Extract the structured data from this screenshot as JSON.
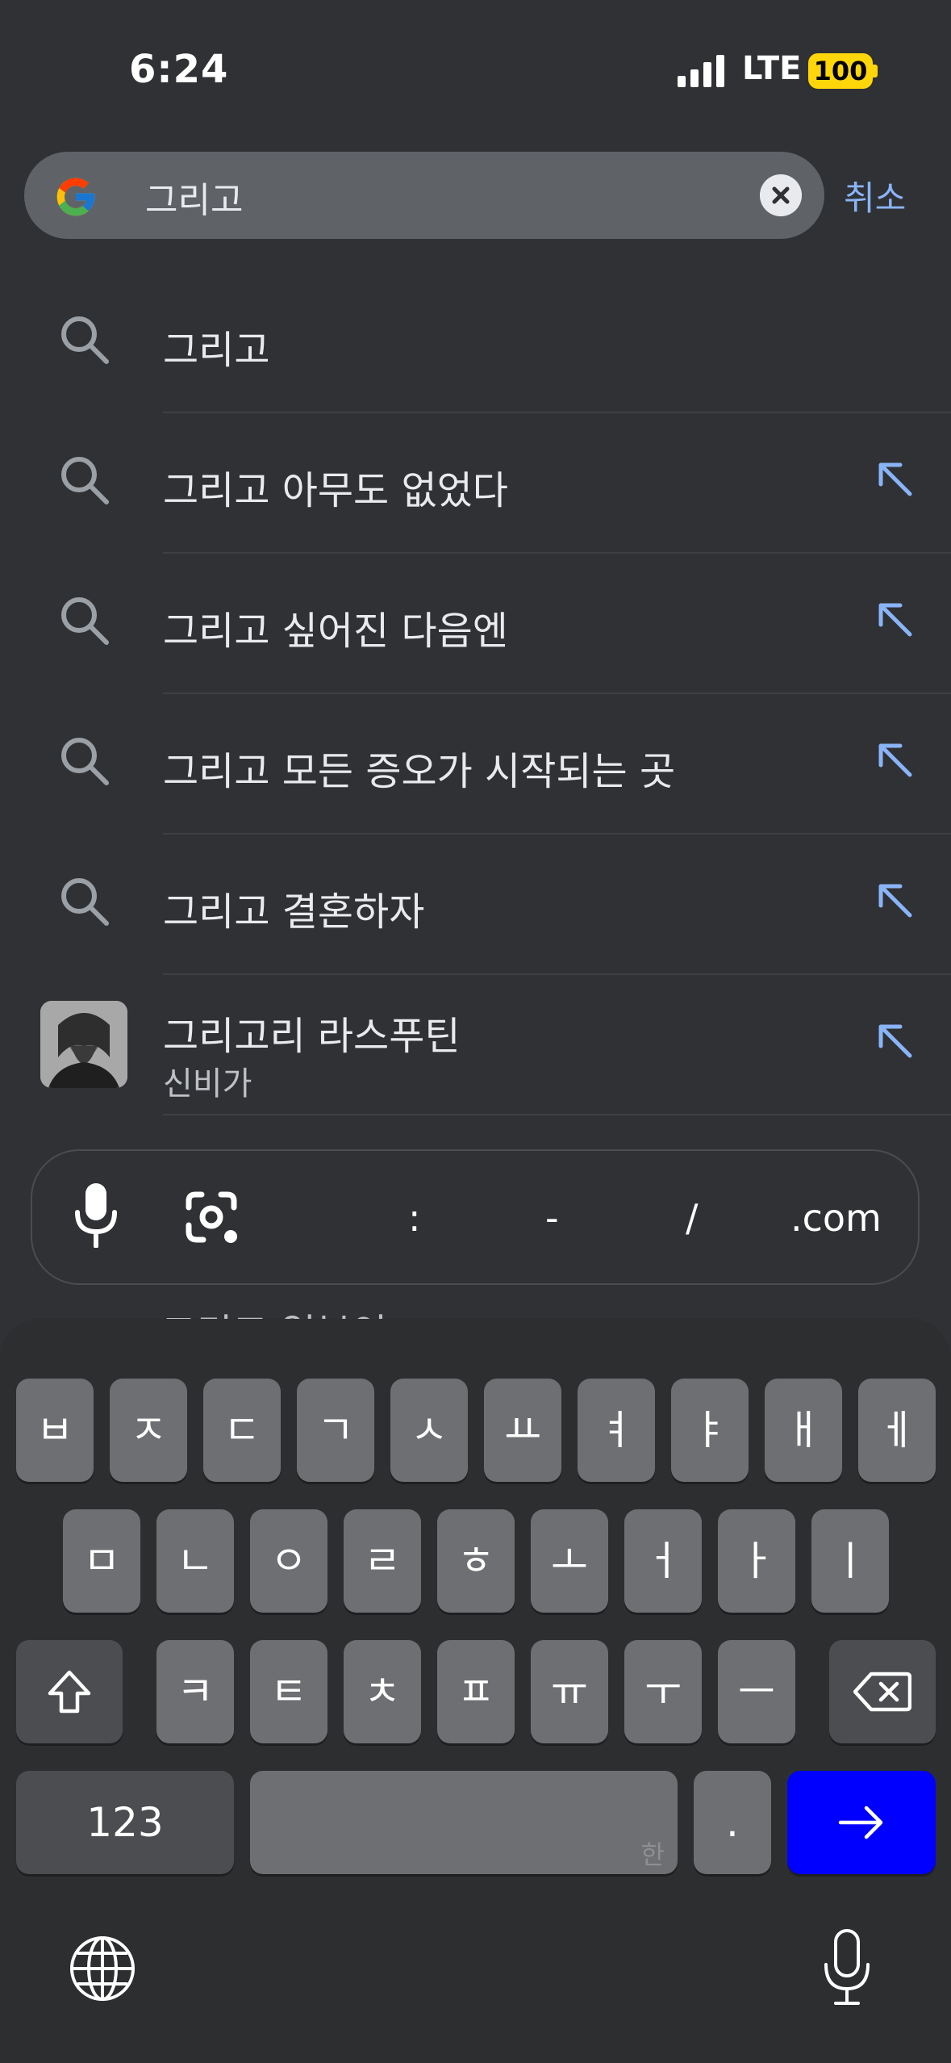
{
  "status": {
    "time": "6:24",
    "carrier": "LTE",
    "battery": "100"
  },
  "search": {
    "query": "그리고",
    "cancel_label": "취소",
    "logo": "google-logo"
  },
  "suggestions": [
    {
      "text": "그리고",
      "arrow": false
    },
    {
      "text": "그리고 아무도 없었다",
      "arrow": true
    },
    {
      "text": "그리고 싶어진 다음엔",
      "arrow": true
    },
    {
      "text": "그리고 모든 증오가 시작되는 곳",
      "arrow": true
    },
    {
      "text": "그리고 결혼하자",
      "arrow": true
    }
  ],
  "entity": {
    "title": "그리고리 라스푸틴",
    "subtitle": "신비가"
  },
  "peek_text": "그리고 일본인",
  "accessory": {
    "colon": ":",
    "dash": "-",
    "slash": "/",
    "dotcom": ".com"
  },
  "keyboard": {
    "row1": [
      "ㅂ",
      "ㅈ",
      "ㄷ",
      "ㄱ",
      "ㅅ",
      "ㅛ",
      "ㅕ",
      "ㅑ",
      "ㅐ",
      "ㅔ"
    ],
    "row2": [
      "ㅁ",
      "ㄴ",
      "ㅇ",
      "ㄹ",
      "ㅎ",
      "ㅗ",
      "ㅓ",
      "ㅏ",
      "ㅣ"
    ],
    "row3": [
      "ㅋ",
      "ㅌ",
      "ㅊ",
      "ㅍ",
      "ㅠ",
      "ㅜ",
      "ㅡ"
    ],
    "numbers_label": "123",
    "space_hint": "한",
    "period_label": "."
  }
}
